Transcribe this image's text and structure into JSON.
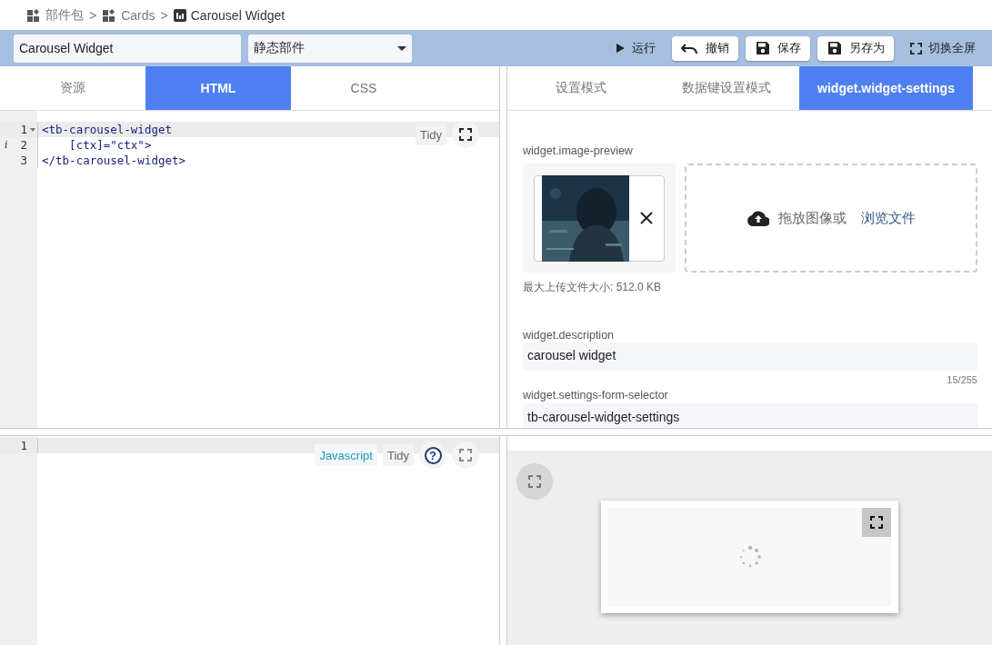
{
  "breadcrumb": {
    "separator": ">",
    "items": [
      {
        "label": "部件包",
        "current": false
      },
      {
        "label": "Cards",
        "current": false
      },
      {
        "label": "Carousel Widget",
        "current": true
      }
    ]
  },
  "toolbar": {
    "name_field": {
      "value": "Carousel Widget"
    },
    "type_select": {
      "value": "静态部件"
    },
    "actions": [
      {
        "label": "运行",
        "kind": "flat"
      },
      {
        "label": "撤销",
        "kind": "raised"
      },
      {
        "label": "保存",
        "kind": "raised"
      },
      {
        "label": "另存为",
        "kind": "raised"
      },
      {
        "label": "切换全屏",
        "kind": "flat"
      }
    ]
  },
  "left_tabs": [
    {
      "label": "资源",
      "selected": false
    },
    {
      "label": "HTML",
      "selected": true
    },
    {
      "label": "CSS",
      "selected": false
    }
  ],
  "html_editor": {
    "tidy": "Tidy",
    "lines": [
      {
        "number": "1",
        "text": "<tb-carousel-widget",
        "foldable": true,
        "active": true
      },
      {
        "number": "2",
        "text": "    [ctx]=\"ctx\">",
        "gutter_mark": "i",
        "foldable": false,
        "active": false
      },
      {
        "number": "3",
        "text": "</tb-carousel-widget>",
        "foldable": false,
        "active": false
      }
    ]
  },
  "js_editor": {
    "language": "Javascript",
    "tidy": "Tidy",
    "help": "?",
    "lines": [
      {
        "number": "1",
        "active": true
      }
    ]
  },
  "right_tabs": [
    {
      "label": "设置模式",
      "selected": false
    },
    {
      "label": "数据键设置模式",
      "selected": false
    },
    {
      "label": "widget.widget-settings",
      "selected": true
    }
  ],
  "settings": {
    "image_preview": {
      "label": "widget.image-preview",
      "drop_text": "拖放图像或",
      "browse_link": "浏览文件",
      "max_size": "最大上传文件大小: 512.0 KB"
    },
    "description": {
      "label": "widget.description",
      "value": "carousel widget",
      "counter": "15/255"
    },
    "settings_form_selector": {
      "label": "widget.settings-form-selector",
      "value": "tb-carousel-widget-settings"
    }
  },
  "preview": {
    "loading": true
  }
}
